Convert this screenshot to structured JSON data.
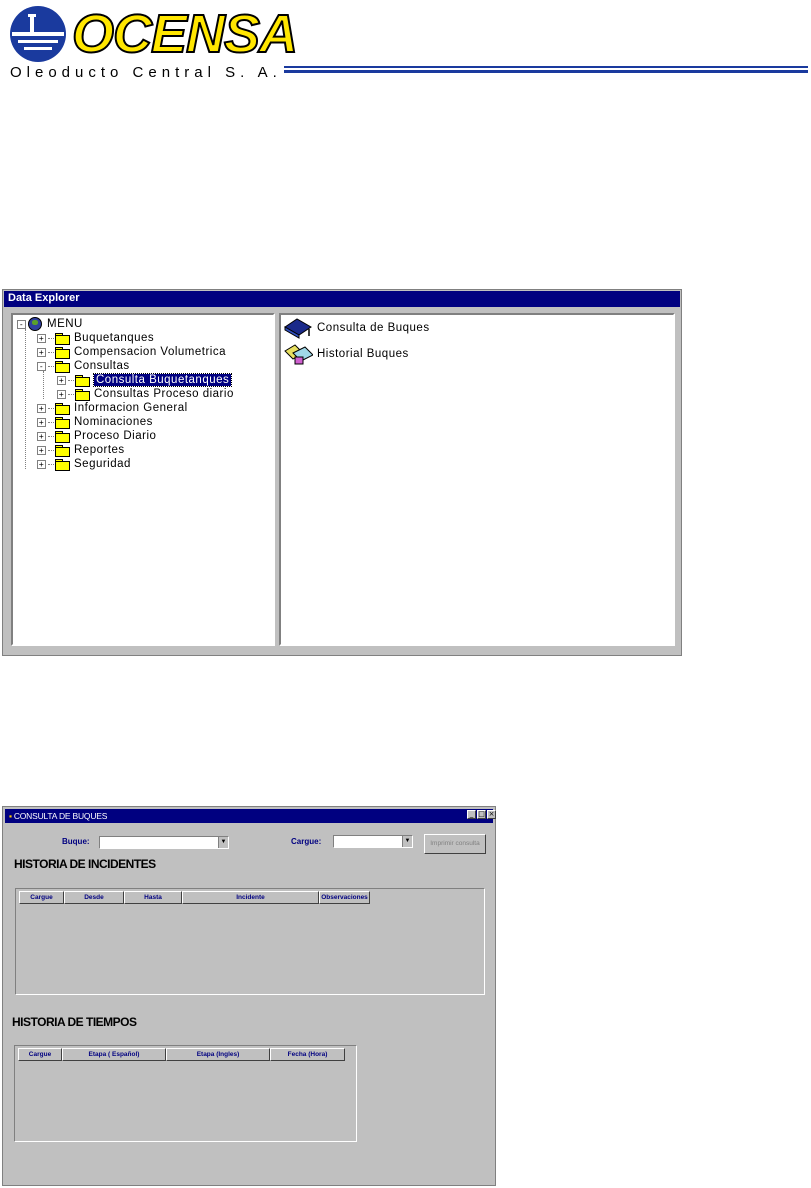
{
  "logo": {
    "wordmark": "OCENSA",
    "subtitle": "Oleoducto Central S. A.",
    "colors": {
      "yellow": "#ffe600",
      "blue": "#1a3a9e"
    }
  },
  "data_explorer": {
    "title": "Data Explorer",
    "tree": {
      "root": "MENU",
      "items": [
        {
          "label": "Buquetanques",
          "expander": "+"
        },
        {
          "label": "Compensacion Volumetrica",
          "expander": "+"
        },
        {
          "label": "Consultas",
          "expander": "-"
        },
        {
          "label": "Consulta Buquetanques",
          "expander": "+",
          "selected": true
        },
        {
          "label": "Consultas Proceso diario",
          "expander": "+"
        },
        {
          "label": "Informacion General",
          "expander": "+"
        },
        {
          "label": "Nominaciones",
          "expander": "+"
        },
        {
          "label": "Proceso Diario",
          "expander": "+"
        },
        {
          "label": "Reportes",
          "expander": "+"
        },
        {
          "label": "Seguridad",
          "expander": "+"
        }
      ]
    },
    "list": [
      {
        "label": "Consulta de Buques",
        "icon": "book-icon"
      },
      {
        "label": "Historial Buques",
        "icon": "book-open-icon"
      }
    ]
  },
  "consulta_buques": {
    "title": "CONSULTA DE BUQUES",
    "window_buttons": {
      "minimize": "_",
      "maximize": "□",
      "close": "×"
    },
    "buque_label": "Buque:",
    "buque_value": "",
    "cargue_label": "Cargue:",
    "cargue_value": "",
    "print_button": "Imprimir consulta",
    "incidentes": {
      "heading": "HISTORIA DE INCIDENTES",
      "columns": [
        "Cargue",
        "Desde",
        "Hasta",
        "Incidente",
        "Observaciones"
      ]
    },
    "tiempos": {
      "heading": "HISTORIA DE TIEMPOS",
      "columns": [
        "Cargue",
        "Etapa ( Español)",
        "Etapa (Ingles)",
        "Fecha (Hora)"
      ]
    }
  }
}
